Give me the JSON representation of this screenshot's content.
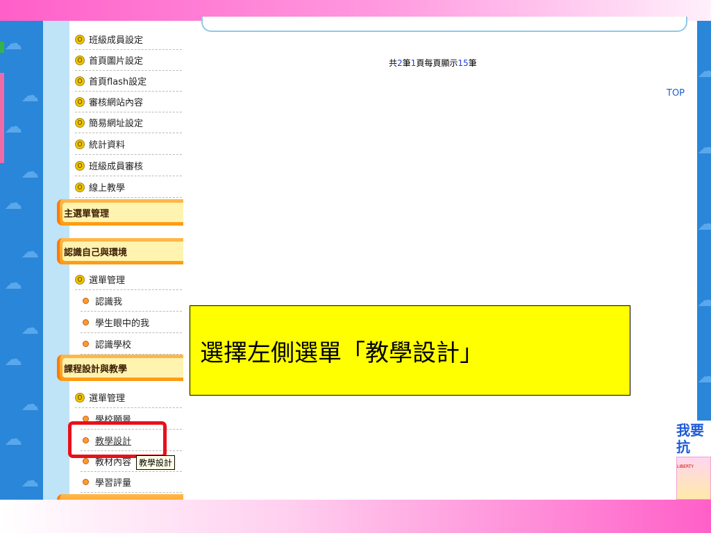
{
  "sidebar": {
    "admin_items": [
      {
        "label": "班級成員設定",
        "icon": "person-icon"
      },
      {
        "label": "首頁圖片設定",
        "icon": "person-icon"
      },
      {
        "label": "首頁flash設定",
        "icon": "person-icon"
      },
      {
        "label": "審核網站內容",
        "icon": "person-icon"
      },
      {
        "label": "簡易網址設定",
        "icon": "person-icon"
      },
      {
        "label": "統計資料",
        "icon": "person-icon"
      },
      {
        "label": "班級成員審核",
        "icon": "person-icon"
      },
      {
        "label": "線上教學",
        "icon": "person-icon"
      }
    ],
    "categories": {
      "main_menu": "主選單管理",
      "self_env": "認識自己與環境",
      "course": "課程設計與教學"
    },
    "self_env_items": [
      {
        "label": "選單管理",
        "icon": "person-icon"
      },
      {
        "label": "認識我",
        "icon": "dot-icon"
      },
      {
        "label": "學生眼中的我",
        "icon": "dot-icon"
      },
      {
        "label": "認識學校",
        "icon": "dot-icon"
      }
    ],
    "course_items": [
      {
        "label": "選單管理",
        "icon": "person-icon"
      },
      {
        "label": "學校願景",
        "icon": "dot-icon"
      },
      {
        "label": "教學設計",
        "icon": "dot-icon"
      },
      {
        "label": "教材內容",
        "icon": "dot-icon"
      },
      {
        "label": "學習評量",
        "icon": "dot-icon"
      }
    ]
  },
  "tooltip": "教學設計",
  "paging": {
    "prefix": "共",
    "total": "2",
    "mid1": "筆",
    "pages": "1",
    "mid2": "頁每頁顯示",
    "per_page": "15",
    "suffix": "筆"
  },
  "top_link": "TOP",
  "callout": "選擇左側選單「教學設計」",
  "ad": {
    "line1": "我要",
    "line2": "抗",
    "label": "LIBERTY"
  },
  "colors": {
    "accent_pink": "#ff5fc8",
    "side_blue": "#2a86d8",
    "callout_yellow": "#ffff00",
    "highlight_red": "#e8101a",
    "category_orange": "#ff9a10"
  }
}
